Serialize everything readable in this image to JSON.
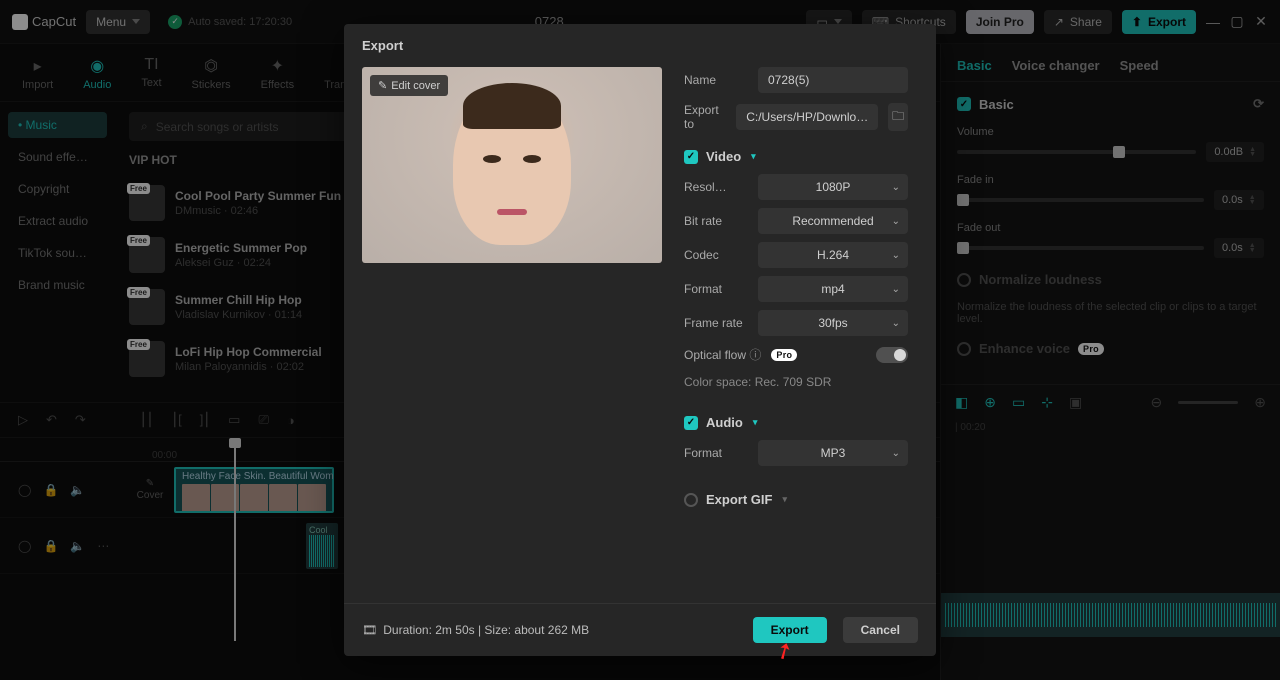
{
  "topbar": {
    "brand": "CapCut",
    "menu": "Menu",
    "autosave": "Auto saved: 17:20:30",
    "title": "0728",
    "shortcuts": "Shortcuts",
    "joinpro": "Join Pro",
    "share": "Share",
    "export": "Export"
  },
  "leftTabs": {
    "import": "Import",
    "audio": "Audio",
    "text": "Text",
    "stickers": "Stickers",
    "effects": "Effects",
    "transitions": "Transitions"
  },
  "audioCats": {
    "music": "Music",
    "soundfx": "Sound effe…",
    "copyright": "Copyright",
    "extract": "Extract audio",
    "tiktok": "TikTok sou…",
    "brand": "Brand music"
  },
  "search": {
    "placeholder": "Search songs or artists"
  },
  "section": "VIP HOT",
  "songs": [
    {
      "title": "Cool Pool Party Summer Fun",
      "meta": "DMmusic · 02:46",
      "badge": "Free"
    },
    {
      "title": "Energetic Summer Pop",
      "meta": "Aleksei Guz · 02:24",
      "badge": "Free"
    },
    {
      "title": "Summer Chill Hip Hop",
      "meta": "Vladislav Kurnikov · 01:14",
      "badge": "Free"
    },
    {
      "title": "LoFi Hip Hop Commercial",
      "meta": "Milan Paloyannidis · 02:02",
      "badge": "Free"
    }
  ],
  "timeline": {
    "ruler_start": "00:00",
    "cover": "Cover",
    "clip_label": "Healthy Face Skin. Beautiful Wom",
    "audio_label": "Cool"
  },
  "rightTabs": {
    "basic": "Basic",
    "voice": "Voice changer",
    "speed": "Speed"
  },
  "rightPanel": {
    "basicSection": "Basic",
    "volume": {
      "label": "Volume",
      "value": "0.0dB"
    },
    "fadein": {
      "label": "Fade in",
      "value": "0.0s"
    },
    "fadeout": {
      "label": "Fade out",
      "value": "0.0s"
    },
    "normalize": {
      "label": "Normalize loudness",
      "desc": "Normalize the loudness of the selected clip or clips to a target level."
    },
    "enhance": {
      "label": "Enhance voice",
      "badge": "Pro"
    },
    "ruler": "| 00:20"
  },
  "modal": {
    "title": "Export",
    "editcover": "Edit cover",
    "name": {
      "label": "Name",
      "value": "0728(5)"
    },
    "exportto": {
      "label": "Export to",
      "value": "C:/Users/HP/Downlo…"
    },
    "video": {
      "header": "Video",
      "resolution": {
        "label": "Resol…",
        "value": "1080P"
      },
      "bitrate": {
        "label": "Bit rate",
        "value": "Recommended"
      },
      "codec": {
        "label": "Codec",
        "value": "H.264"
      },
      "format": {
        "label": "Format",
        "value": "mp4"
      },
      "framerate": {
        "label": "Frame rate",
        "value": "30fps"
      },
      "opticalflow": {
        "label": "Optical flow",
        "badge": "Pro"
      },
      "colorspace": "Color space: Rec. 709 SDR"
    },
    "audio": {
      "header": "Audio",
      "format": {
        "label": "Format",
        "value": "MP3"
      }
    },
    "gif": {
      "header": "Export GIF"
    },
    "footer": {
      "duration": "Duration: 2m 50s | Size: about 262 MB",
      "export": "Export",
      "cancel": "Cancel"
    }
  }
}
